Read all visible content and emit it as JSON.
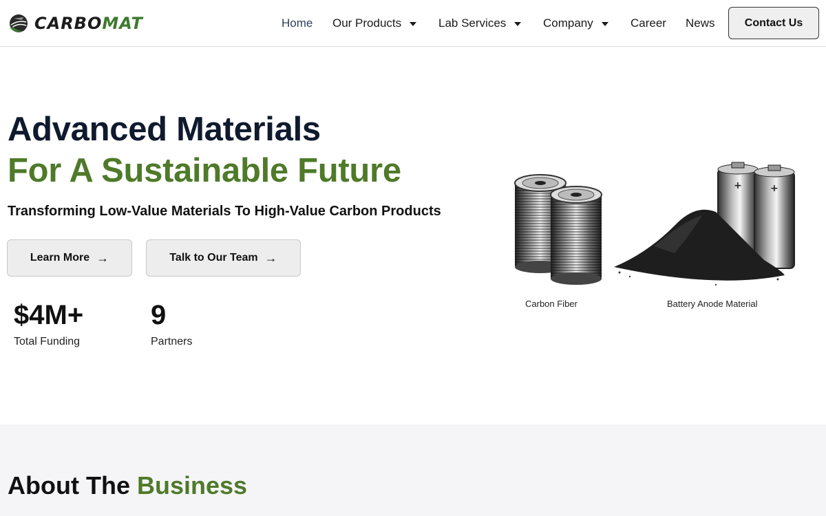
{
  "brand": {
    "name_part1": "CARBO",
    "name_part2": "MAT"
  },
  "nav": {
    "home": "Home",
    "products": "Our Products",
    "lab": "Lab Services",
    "company": "Company",
    "career": "Career",
    "news": "News",
    "contact": "Contact Us"
  },
  "hero": {
    "title_line1": "Advanced Materials",
    "title_line2": "For A Sustainable Future",
    "subtitle": "Transforming Low-Value Materials To High-Value Carbon Products",
    "learn_more": "Learn More",
    "talk_team": "Talk to Our Team",
    "arrow": "→"
  },
  "stats": [
    {
      "value": "$4M+",
      "label": "Total Funding"
    },
    {
      "value": "9",
      "label": "Partners"
    }
  ],
  "illustration": {
    "caption_fiber": "Carbon Fiber",
    "caption_anode": "Battery Anode Material"
  },
  "about": {
    "title_part1": "About The ",
    "title_part2": "Business"
  },
  "colors": {
    "accent_green": "#4f7a2a",
    "dark_navy": "#0f1a2e",
    "section_bg": "#f5f5f7"
  }
}
